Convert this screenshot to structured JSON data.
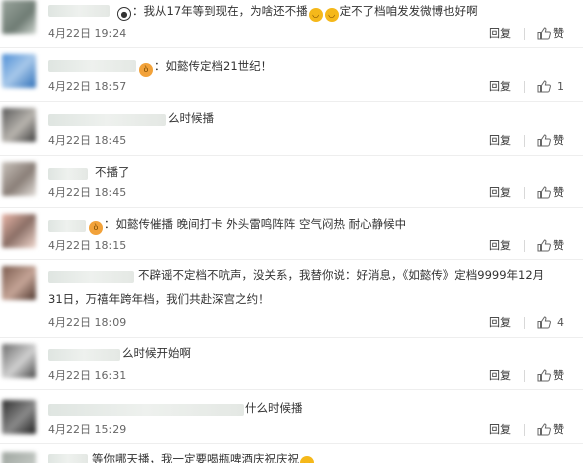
{
  "comments": [
    {
      "text_a": "：我从17年等到现在，为啥还不播",
      "text_b": "定不了档咱发发微博也好啊",
      "time": "4月22日 19:24",
      "reply": "回复",
      "like": "赞",
      "emoji": [
        "panda",
        "laugh-cry",
        "laugh-cry"
      ]
    },
    {
      "text_a": "：如懿传定档21世纪！",
      "time": "4月22日 18:57",
      "reply": "回复",
      "like": "1",
      "emoji": [
        "angry"
      ]
    },
    {
      "text_a": "么时候播",
      "time": "4月22日 18:45",
      "reply": "回复",
      "like": "赞"
    },
    {
      "text_a": "不播了",
      "time": "4月22日 18:45",
      "reply": "回复",
      "like": "赞"
    },
    {
      "text_a": "：如懿传催播 晚间打卡 外头雷鸣阵阵 空气闷热 耐心静候中",
      "time": "4月22日 18:15",
      "reply": "回复",
      "like": "赞",
      "emoji": [
        "angry"
      ]
    },
    {
      "text_a": "不辟谣不定档不吭声，没关系，我替你说：好消息，《如懿传》定档9999年12月",
      "text_b": "31日，万禧年跨年档，我们共赴深宫之约！",
      "time": "4月22日 18:09",
      "reply": "回复",
      "like": "4"
    },
    {
      "text_a": "么时候开始啊",
      "time": "4月22日 16:31",
      "reply": "回复",
      "like": "赞"
    },
    {
      "text_a": "什么时候播",
      "time": "4月22日 15:29",
      "reply": "回复",
      "like": "赞"
    },
    {
      "text_a": "等你哪天播，我一定要喝瓶啤酒庆祝庆祝"
    }
  ]
}
